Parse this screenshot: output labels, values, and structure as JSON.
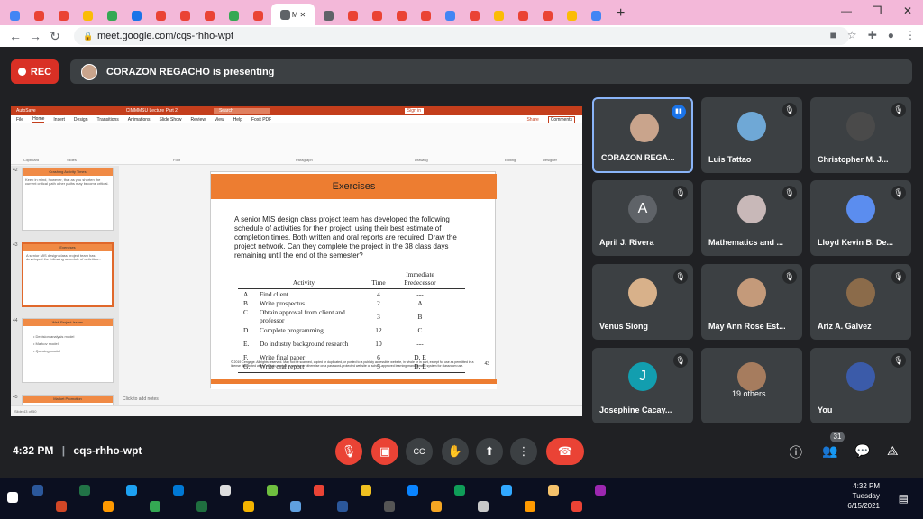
{
  "browser": {
    "tab_label": "M",
    "tab_close": "✕",
    "new_tab": "+",
    "url": "meet.google.com/cqs-rhho-wpt"
  },
  "meet": {
    "rec_label": "REC",
    "presenter_banner": "CORAZON REGACHO is presenting",
    "meeting_code": "cqs-rhho-wpt",
    "time": "4:32 PM",
    "participant_count": "31"
  },
  "ppt": {
    "title_left": "AutoSave",
    "title_center": "CIMMMSU Lecture Part 2",
    "search": "Search",
    "signin": "Sign in",
    "menu": [
      "File",
      "Home",
      "Insert",
      "Design",
      "Transitions",
      "Animations",
      "Slide Show",
      "Review",
      "View",
      "Help",
      "Foxit PDF"
    ],
    "share": "Share",
    "comments": "Comments",
    "ribbon_groups": [
      "Clipboard",
      "Slides",
      "Font",
      "Paragraph",
      "Drawing",
      "Editing",
      "Designer"
    ],
    "thumb_numbers": [
      "42",
      "43",
      "44",
      "45"
    ],
    "thumb_titles": [
      "Crashing Activity Times",
      "Exercises",
      "Web Project Issues",
      "Market Promotion"
    ],
    "notes": "Click to add notes",
    "status": "Slide 43 of 50"
  },
  "slide": {
    "heading": "Exercises",
    "body": "A senior MIS design class project team has developed the following schedule of activities for their project, using their best estimate of completion times. Both written and oral reports are required. Draw the project network. Can they complete the project in the 38 class days remaining until the end of the semester?",
    "columns": [
      "Activity",
      "Time",
      "Immediate Predecessor"
    ],
    "rows": [
      {
        "id": "A.",
        "activity": "Find client",
        "time": "4",
        "pred": "---"
      },
      {
        "id": "B.",
        "activity": "Write prospectus",
        "time": "2",
        "pred": "A"
      },
      {
        "id": "C.",
        "activity": "Obtain approval from client and professor",
        "time": "3",
        "pred": "B"
      },
      {
        "id": "D.",
        "activity": "Complete programming",
        "time": "12",
        "pred": "C"
      },
      {
        "id": "E.",
        "activity": "Do industry background research",
        "time": "10",
        "pred": "---"
      },
      {
        "id": "F.",
        "activity": "Write final paper",
        "time": "6",
        "pred": "D, E"
      },
      {
        "id": "G.",
        "activity": "Write oral report",
        "time": "5",
        "pred": "D, E"
      }
    ],
    "footer": "© 2019 Cengage. All rights reserved. May not be scanned, copied or duplicated, or posted to a publicly accessible website, in whole or in part, except for use as permitted in a license distributed with a certain product or service or otherwise on a password-protected website or school-approved learning management system for classroom use.",
    "page": "43"
  },
  "participants": [
    {
      "name": "CORAZON REGA...",
      "initial": "",
      "color": "#c9a48c"
    },
    {
      "name": "Luis Tattao",
      "initial": "",
      "color": "#6fa8d6"
    },
    {
      "name": "Christopher M. J...",
      "initial": "",
      "color": "#4a4a4a"
    },
    {
      "name": "April J. Rivera",
      "initial": "A",
      "color": "#5f6368"
    },
    {
      "name": "Mathematics and ...",
      "initial": "",
      "color": "#c8b8b8"
    },
    {
      "name": "Lloyd Kevin B. De...",
      "initial": "",
      "color": "#5b8def"
    },
    {
      "name": "Venus Siong",
      "initial": "",
      "color": "#d8b18a"
    },
    {
      "name": "May Ann Rose Est...",
      "initial": "",
      "color": "#c49a7a"
    },
    {
      "name": "Ariz A. Galvez",
      "initial": "",
      "color": "#8b6b4a"
    },
    {
      "name": "Josephine Cacay...",
      "initial": "J",
      "color": "#129eaf"
    },
    {
      "name": "19 others",
      "initial": "",
      "color": "#a67c5e"
    },
    {
      "name": "You",
      "initial": "",
      "color": "#3b5ba9"
    }
  ],
  "taskbar": {
    "time": "4:32 PM",
    "day": "Tuesday",
    "date": "6/15/2021"
  },
  "colors": {
    "accent_orange": "#ed7d31",
    "rec_red": "#d93025",
    "ppt_red": "#c43e1c"
  }
}
